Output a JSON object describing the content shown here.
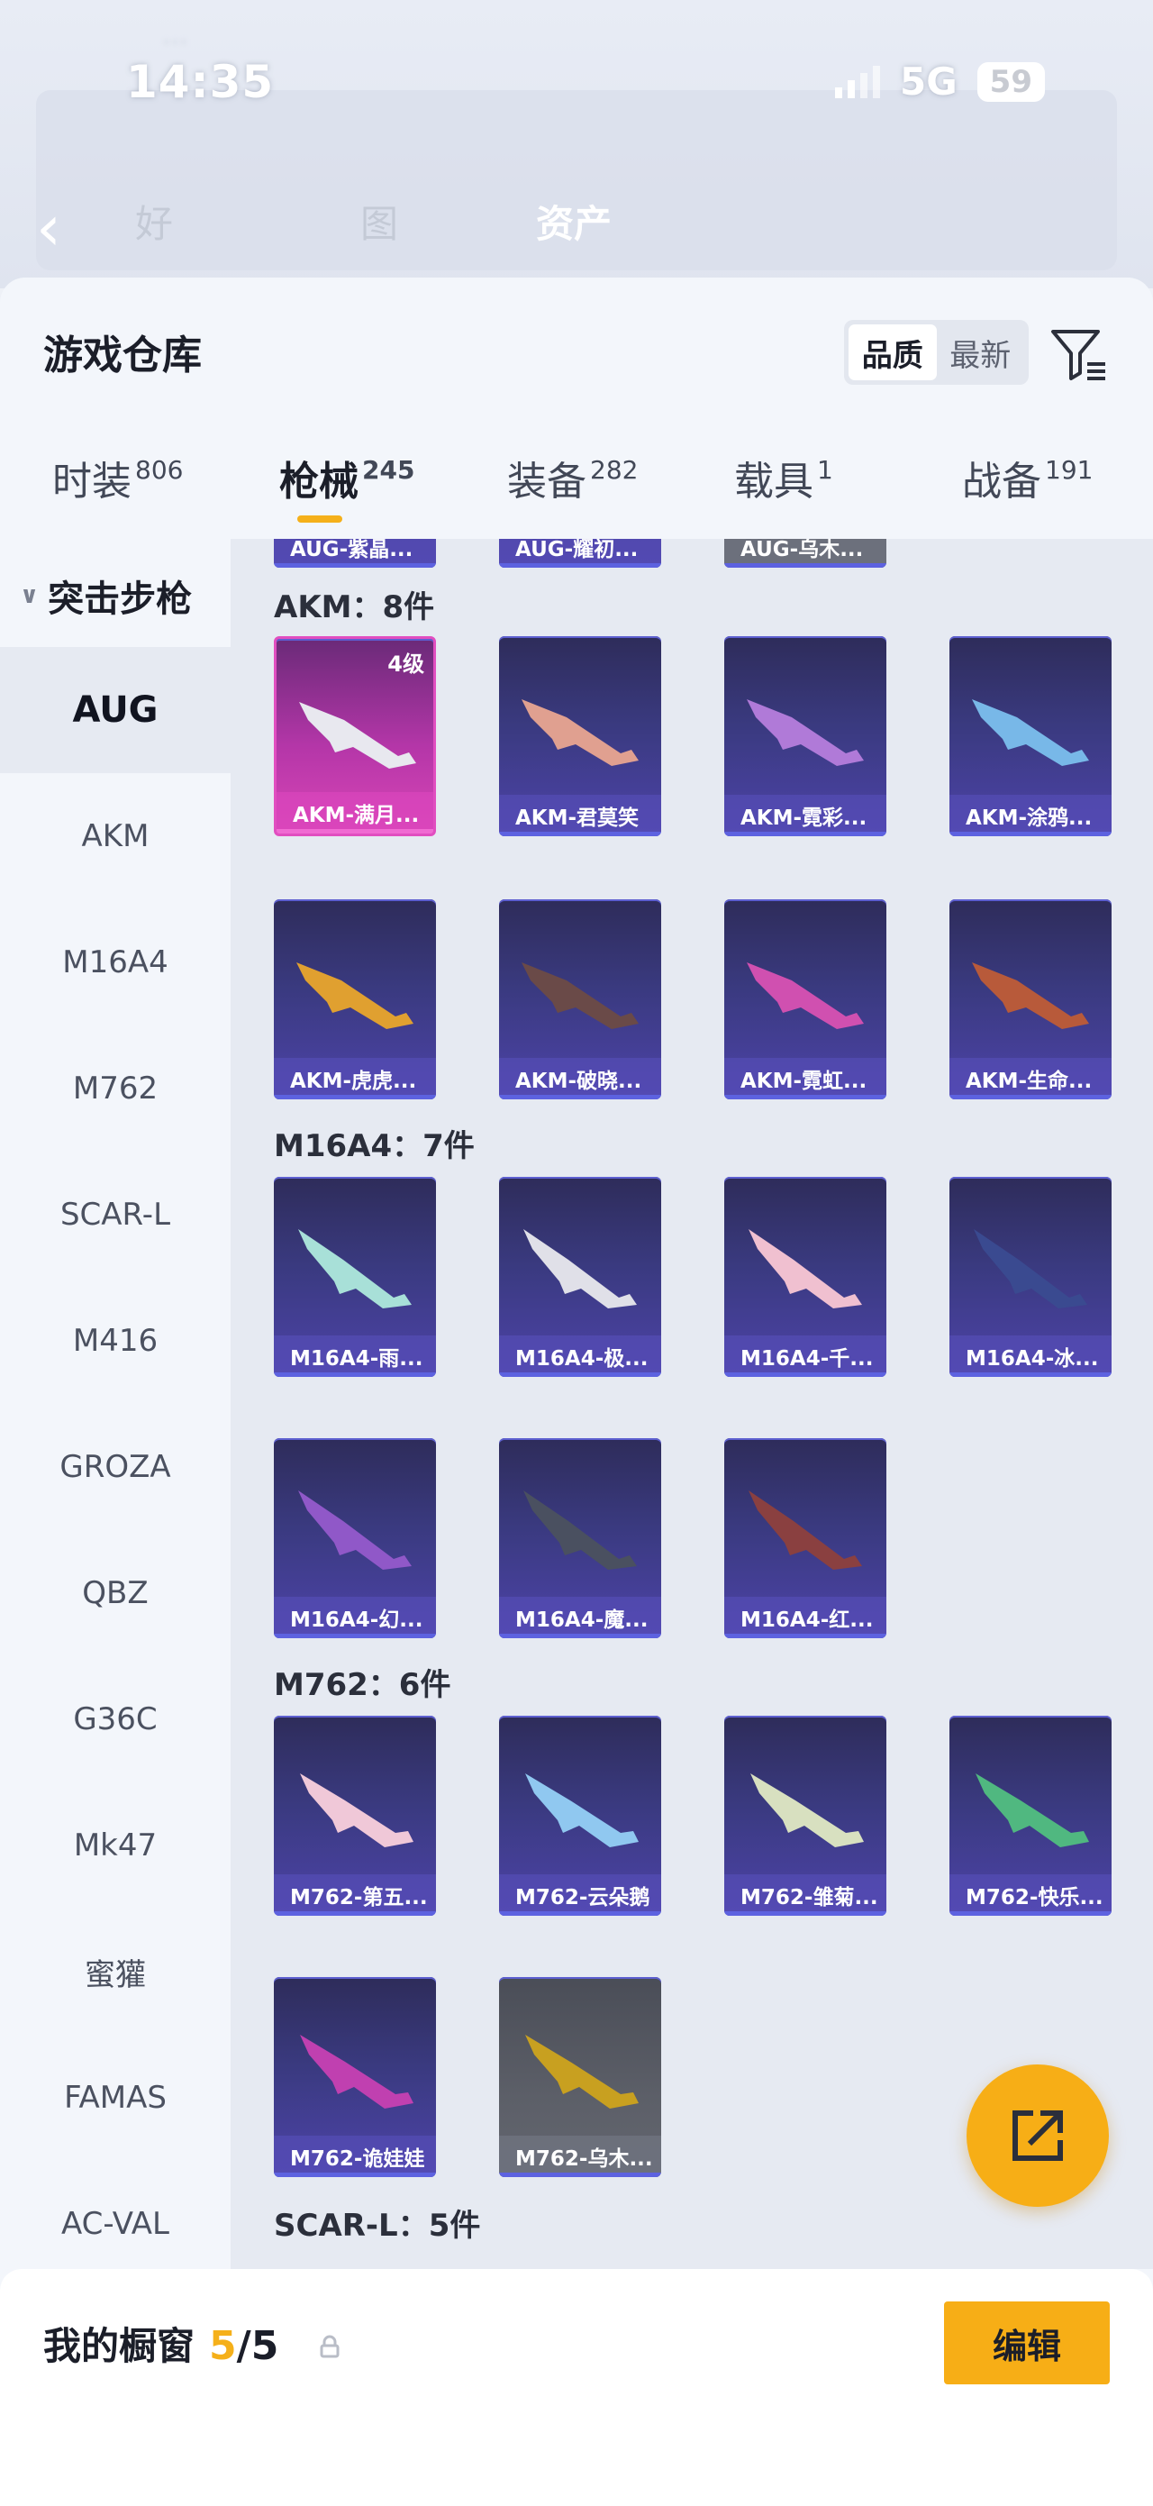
{
  "status": {
    "time": "14:35",
    "network": "5G",
    "battery": "59"
  },
  "background_nav": {
    "tabs": [
      "好",
      "图",
      "资产"
    ]
  },
  "sheet": {
    "title": "游戏仓库",
    "sort_options": [
      "品质",
      "最新"
    ],
    "sort_selected": "品质"
  },
  "tabs": [
    {
      "label": "时装",
      "count": "806"
    },
    {
      "label": "枪械",
      "count": "245"
    },
    {
      "label": "装备",
      "count": "282"
    },
    {
      "label": "载具",
      "count": "1"
    },
    {
      "label": "战备",
      "count": "191"
    }
  ],
  "active_tab": "枪械",
  "sidebar": {
    "category": "突击步枪",
    "items": [
      "AUG",
      "AKM",
      "M16A4",
      "M762",
      "SCAR-L",
      "M416",
      "GROZA",
      "QBZ",
      "G36C",
      "Mk47",
      "蜜獾",
      "FAMAS",
      "AC-VAL"
    ],
    "active": "AUG"
  },
  "groups": {
    "aug_partial": [
      "AUG-紫晶...",
      "AUG-耀初...",
      "AUG-乌木..."
    ],
    "akm": {
      "label": "AKM：8件",
      "items": [
        {
          "name": "AKM-满月...",
          "level": "4级",
          "rarity": "pink"
        },
        {
          "name": "AKM-君莫笑",
          "rarity": "purple"
        },
        {
          "name": "AKM-霓彩...",
          "rarity": "purple"
        },
        {
          "name": "AKM-涂鸦...",
          "rarity": "purple"
        },
        {
          "name": "AKM-虎虎...",
          "rarity": "purple"
        },
        {
          "name": "AKM-破晓...",
          "rarity": "purple"
        },
        {
          "name": "AKM-霓虹...",
          "rarity": "purple"
        },
        {
          "name": "AKM-生命...",
          "rarity": "purple"
        }
      ]
    },
    "m16a4": {
      "label": "M16A4：7件",
      "items": [
        {
          "name": "M16A4-雨...",
          "rarity": "purple"
        },
        {
          "name": "M16A4-极...",
          "rarity": "purple"
        },
        {
          "name": "M16A4-千...",
          "rarity": "purple"
        },
        {
          "name": "M16A4-冰...",
          "rarity": "purple"
        },
        {
          "name": "M16A4-幻...",
          "rarity": "purple"
        },
        {
          "name": "M16A4-魔...",
          "rarity": "purple"
        },
        {
          "name": "M16A4-红...",
          "rarity": "purple"
        }
      ]
    },
    "m762": {
      "label": "M762：6件",
      "items": [
        {
          "name": "M762-第五...",
          "rarity": "purple"
        },
        {
          "name": "M762-云朵鹅",
          "rarity": "purple"
        },
        {
          "name": "M762-雏菊...",
          "rarity": "purple"
        },
        {
          "name": "M762-快乐...",
          "rarity": "purple"
        },
        {
          "name": "M762-诡娃娃",
          "rarity": "purple"
        },
        {
          "name": "M762-乌木...",
          "rarity": "gray"
        }
      ]
    },
    "scarl": {
      "label": "SCAR-L：5件"
    }
  },
  "bottom": {
    "showcase_label": "我的橱窗",
    "showcase_current": "5",
    "showcase_total": "/5",
    "edit_label": "编辑"
  },
  "colors": {
    "accent": "#f5b01a",
    "epic": "#4d43a8",
    "legendary": "#d945b6",
    "common": "#5c5f68"
  },
  "icons": [
    "filter-icon",
    "share-icon",
    "lock-icon",
    "chevron-down-icon",
    "back-icon"
  ]
}
